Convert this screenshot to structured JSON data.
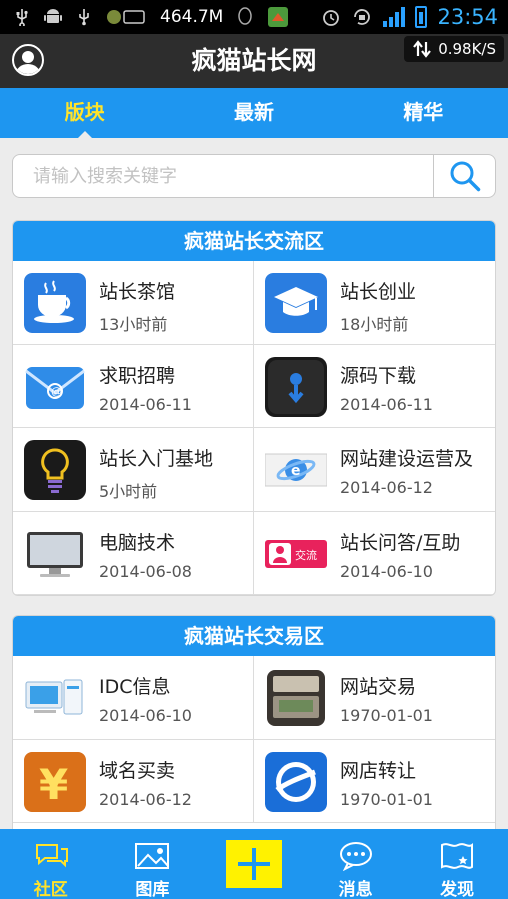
{
  "status_bar": {
    "memory": "464.7M",
    "time": "23:54",
    "network_speed": "0.98K/S"
  },
  "header": {
    "title": "疯猫站长网"
  },
  "tabs": [
    {
      "label": "版块",
      "active": true
    },
    {
      "label": "最新",
      "active": false
    },
    {
      "label": "精华",
      "active": false
    }
  ],
  "search": {
    "placeholder": "请输入搜索关键字",
    "value": ""
  },
  "sections": [
    {
      "title": "疯猫站长交流区",
      "items": [
        {
          "name": "站长茶馆",
          "time": "13小时前",
          "icon": "teacup-icon"
        },
        {
          "name": "站长创业",
          "time": "18小时前",
          "icon": "graduation-cap-icon"
        },
        {
          "name": "求职招聘",
          "time": "2014-06-11",
          "icon": "mail-icon"
        },
        {
          "name": "源码下载",
          "time": "2014-06-11",
          "icon": "download-icon"
        },
        {
          "name": "站长入门基地",
          "time": "5小时前",
          "icon": "lightbulb-icon"
        },
        {
          "name": "网站建设运营及",
          "time": "2014-06-12",
          "icon": "ie-globe-icon"
        },
        {
          "name": "电脑技术",
          "time": "2014-06-08",
          "icon": "monitor-icon"
        },
        {
          "name": "站长问答/互助",
          "time": "2014-06-10",
          "icon": "exchange-badge-icon",
          "badge": "交流"
        }
      ]
    },
    {
      "title": "疯猫站长交易区",
      "items": [
        {
          "name": "IDC信息",
          "time": "2014-06-10",
          "icon": "server-icon"
        },
        {
          "name": "网站交易",
          "time": "1970-01-01",
          "icon": "cash-register-icon"
        },
        {
          "name": "域名买卖",
          "time": "2014-06-12",
          "icon": "yen-icon"
        },
        {
          "name": "网店转让",
          "time": "1970-01-01",
          "icon": "earth-icon"
        }
      ]
    }
  ],
  "bottom_nav": [
    {
      "label": "社区",
      "active": true,
      "icon": "chat-bubbles-icon"
    },
    {
      "label": "图库",
      "active": false,
      "icon": "picture-icon"
    },
    {
      "label": "",
      "active": false,
      "icon": "plus-icon"
    },
    {
      "label": "消息",
      "active": false,
      "icon": "message-icon"
    },
    {
      "label": "发现",
      "active": false,
      "icon": "map-flag-icon"
    }
  ],
  "colors": {
    "primary": "#1e96f0",
    "active_accent": "#ffe32a",
    "title_bar": "#2d2d2d",
    "plus_button": "#fff200"
  }
}
